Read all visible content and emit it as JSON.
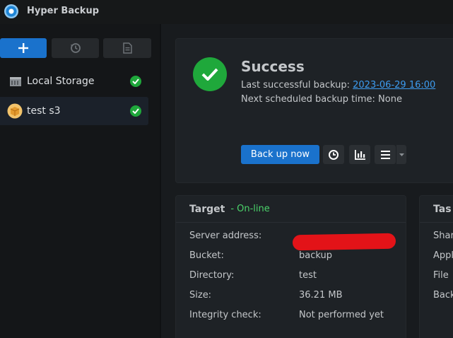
{
  "app": {
    "title": "Hyper Backup",
    "icon": "hyper-backup-logo-icon"
  },
  "toolbar": {
    "add_icon": "plus-icon",
    "history_icon": "history-icon",
    "log_icon": "document-icon"
  },
  "sidebar": {
    "items": [
      {
        "label": "Local Storage",
        "icon": "storage-icon",
        "status_icon": "check-circle-icon",
        "selected": false
      },
      {
        "label": "test s3",
        "icon": "s3-bucket-icon",
        "status_icon": "check-circle-icon",
        "selected": true
      }
    ]
  },
  "status": {
    "title": "Success",
    "last_backup_label": "Last successful backup:",
    "last_backup_value": "2023-06-29 16:00",
    "next_backup_text": "Next scheduled backup time: None",
    "backup_now_label": "Back up now",
    "buttons": [
      "restore-clock-icon",
      "statistics-bars-icon",
      "menu-lines-icon",
      "caret-down-icon"
    ]
  },
  "target": {
    "title": "Target",
    "state": "- On-line",
    "rows": [
      {
        "label": "Server address:",
        "value": ""
      },
      {
        "label": "Bucket:",
        "value": "backup"
      },
      {
        "label": "Directory:",
        "value": "test"
      },
      {
        "label": "Size:",
        "value": "36.21 MB"
      },
      {
        "label": "Integrity check:",
        "value": "Not performed yet"
      }
    ]
  },
  "task": {
    "title": "Tas",
    "rows": [
      "Shar",
      "Appl",
      "File",
      "Back"
    ]
  },
  "colors": {
    "accent": "#1a72cc",
    "success": "#1fa83b",
    "online": "#4bd36a",
    "link": "#3d9cf0",
    "redaction": "#e31318"
  }
}
